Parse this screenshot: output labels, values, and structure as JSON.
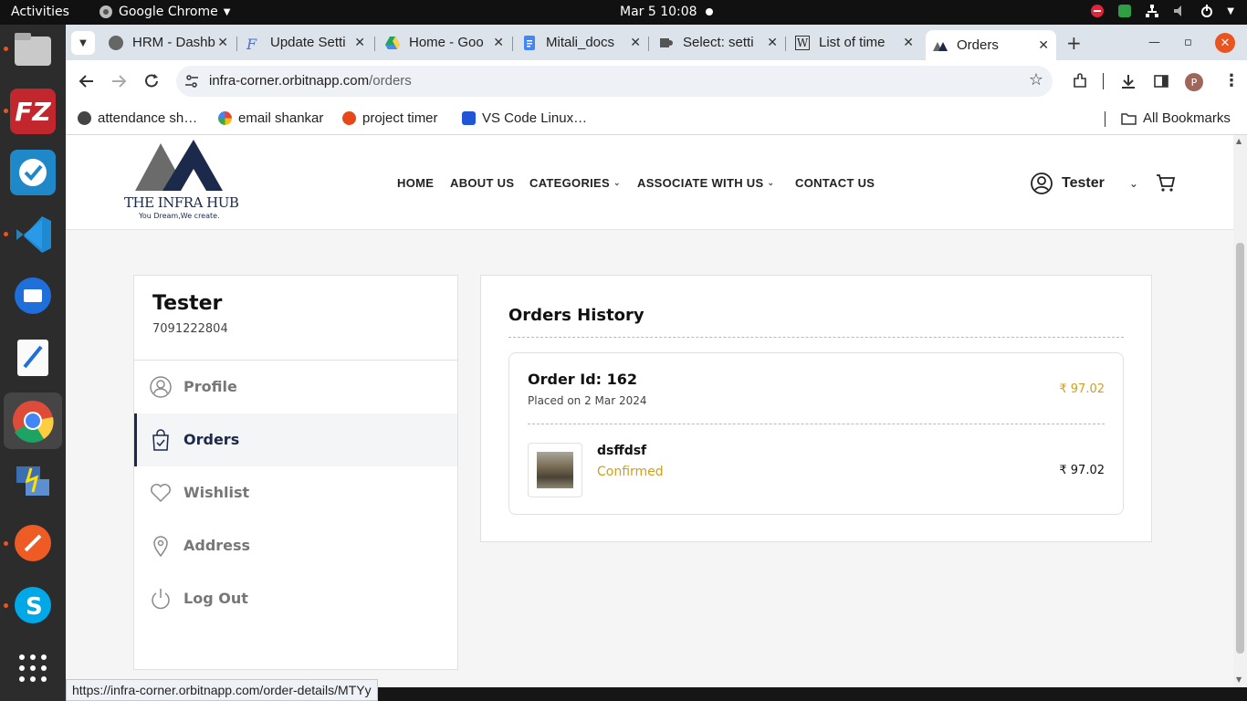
{
  "topbar": {
    "activities": "Activities",
    "app_name": "Google Chrome",
    "clock": "Mar 5  10:08"
  },
  "browser": {
    "tabs": [
      {
        "label": "HRM - Dashb"
      },
      {
        "label": "Update Setti"
      },
      {
        "label": "Home - Goo"
      },
      {
        "label": "Mitali_docs"
      },
      {
        "label": "Select: setti"
      },
      {
        "label": "List of time"
      },
      {
        "label": "Orders"
      }
    ],
    "url_host": "infra-corner.orbitnapp.com",
    "url_path": "/orders",
    "profile_initial": "P",
    "bookmarks": [
      {
        "label": "attendance sh…"
      },
      {
        "label": "email shankar"
      },
      {
        "label": "project timer"
      },
      {
        "label": "VS Code Linux…"
      }
    ],
    "all_bookmarks": "All Bookmarks",
    "status_url": "https://infra-corner.orbitnapp.com/order-details/MTYy"
  },
  "site": {
    "brand": "THE INFRA HUB",
    "tagline": "You Dream,We create.",
    "nav": {
      "home": "HOME",
      "about": "ABOUT US",
      "categories": "CATEGORIES",
      "associate": "ASSOCIATE WITH US",
      "contact": "CONTACT US"
    },
    "user_name": "Tester"
  },
  "sidebar": {
    "name": "Tester",
    "phone": "7091222804",
    "items": [
      {
        "label": "Profile"
      },
      {
        "label": "Orders"
      },
      {
        "label": "Wishlist"
      },
      {
        "label": "Address"
      },
      {
        "label": "Log Out"
      }
    ]
  },
  "orders": {
    "title": "Orders History",
    "order": {
      "id_label": "Order Id: 162",
      "placed": "Placed on 2 Mar 2024",
      "total": "₹ 97.02",
      "item": {
        "name": "dsffdsf",
        "status": "Confirmed",
        "price": "₹ 97.02"
      }
    }
  },
  "colors": {
    "accent_gold": "#d39e17",
    "brand_navy": "#1b2a4a",
    "ubuntu_orange": "#e95420"
  }
}
